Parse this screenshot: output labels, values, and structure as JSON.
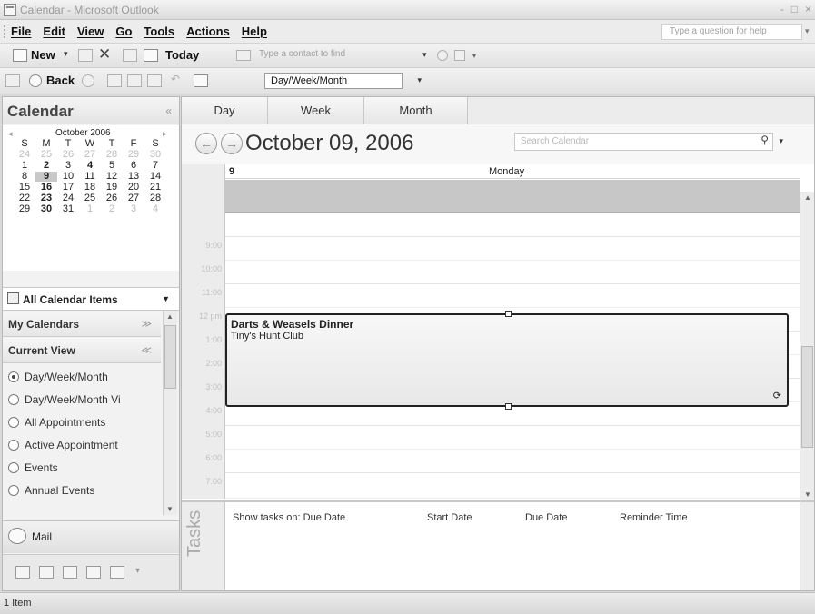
{
  "window": {
    "title": "Calendar - Microsoft Outlook",
    "buttons": [
      "-",
      "□",
      "×"
    ]
  },
  "menu": {
    "items": [
      "File",
      "Edit",
      "View",
      "Go",
      "Tools",
      "Actions",
      "Help"
    ],
    "help_placeholder": "Type a question for help"
  },
  "toolbar1": {
    "new_label": "New",
    "today_label": "Today",
    "contact_placeholder": "Type a contact to find"
  },
  "toolbar2": {
    "back_label": "Back",
    "view_select": "Day/Week/Month"
  },
  "nav": {
    "title": "Calendar",
    "mini_calendar": {
      "month": "October 2006",
      "weekdays": [
        "S",
        "M",
        "T",
        "W",
        "T",
        "F",
        "S"
      ],
      "weeks": [
        [
          "24",
          "25",
          "26",
          "27",
          "28",
          "29",
          "30"
        ],
        [
          "1",
          "2",
          "3",
          "4",
          "5",
          "6",
          "7"
        ],
        [
          "8",
          "9",
          "10",
          "11",
          "12",
          "13",
          "14"
        ],
        [
          "15",
          "16",
          "17",
          "18",
          "19",
          "20",
          "21"
        ],
        [
          "22",
          "23",
          "24",
          "25",
          "26",
          "27",
          "28"
        ],
        [
          "29",
          "30",
          "31",
          "1",
          "2",
          "3",
          "4"
        ]
      ],
      "selected": "9"
    },
    "all_items": "All Calendar Items",
    "sections": {
      "my_calendars": "My Calendars",
      "current_view": "Current View"
    },
    "views": [
      "Day/Week/Month",
      "Day/Week/Month Vi",
      "All Appointments",
      "Active Appointment",
      "Events",
      "Annual Events"
    ],
    "selected_view": "Day/Week/Month",
    "mail_label": "Mail"
  },
  "calendar": {
    "tabs": [
      "Day",
      "Week",
      "Month"
    ],
    "active_tab": "Day",
    "date_title": "October 09, 2006",
    "search_placeholder": "Search Calendar",
    "day_number": "9",
    "day_name": "Monday",
    "times": [
      "9:00",
      "10:00",
      "11:00",
      "12 pm",
      "1:00",
      "2:00",
      "3:00",
      "4:00",
      "5:00",
      "6:00",
      "7:00"
    ],
    "appointment": {
      "title": "Darts & Weasels Dinner",
      "location": "Tiny's Hunt Club"
    }
  },
  "tasks": {
    "label": "Tasks",
    "show_on": "Show tasks on: Due Date",
    "columns": [
      "Start Date",
      "Due Date",
      "Reminder Time"
    ]
  },
  "status": {
    "text": "1 Item"
  }
}
